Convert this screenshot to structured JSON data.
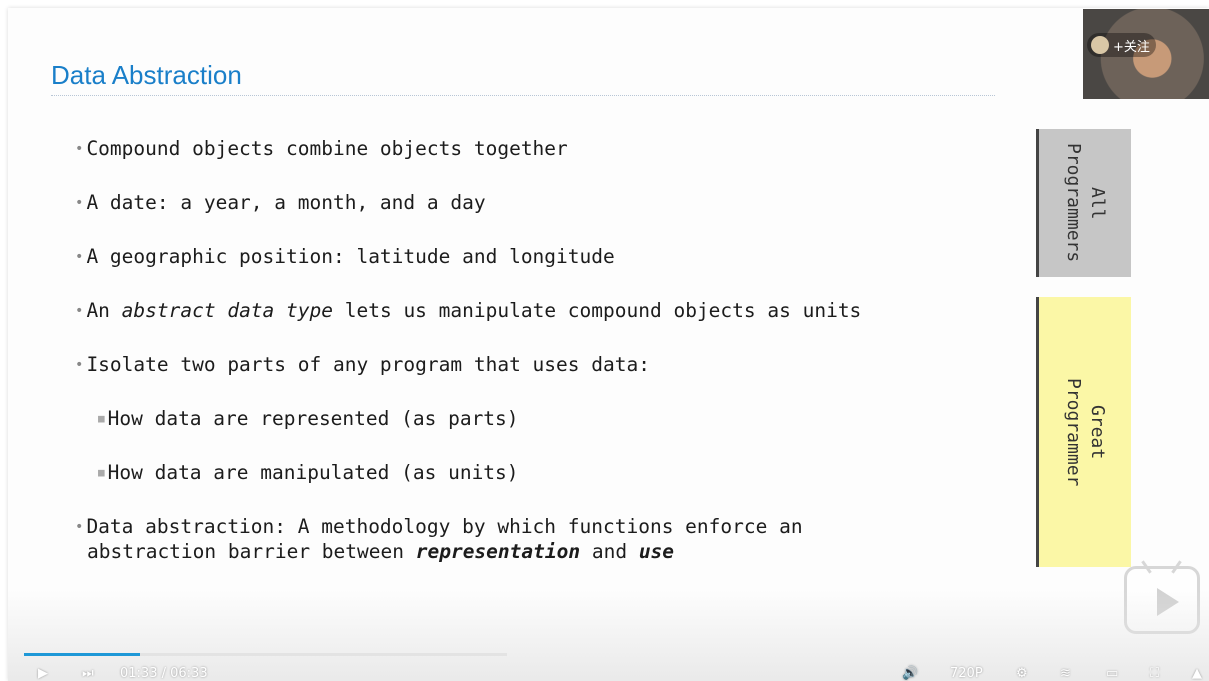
{
  "slide": {
    "title": "Data Abstraction",
    "bullets": [
      {
        "text": "Compound objects combine objects together"
      },
      {
        "text": "A date: a year, a month, and a day"
      },
      {
        "text": "A geographic position: latitude and longitude"
      },
      {
        "pre": "An ",
        "em": "abstract data type",
        "post": " lets us manipulate compound objects as units"
      },
      {
        "text": "Isolate two parts of any program that uses data:"
      },
      {
        "text": "How data are represented (as parts)"
      },
      {
        "text": "How data are manipulated (as units)"
      },
      {
        "line1": "Data abstraction: A methodology by which functions enforce an",
        "line2_pre": "abstraction barrier between ",
        "line2_em1": "representation",
        "line2_mid": " and ",
        "line2_em2": "use"
      }
    ],
    "side_boxes": {
      "all": "All\nProgrammers",
      "great": "Great\nProgrammer",
      "all_color": "#c6c6c6",
      "great_color": "#fbf7a6"
    },
    "title_color": "#1a7fc9"
  },
  "webcam": {
    "follow_label": "+关注"
  },
  "player": {
    "time_current": "01:33",
    "time_total": "06:33",
    "time_sep": " / ",
    "quality": "720P",
    "progress_fraction": 0.24,
    "accent": "#1e98d7",
    "icons": [
      "play-icon",
      "next-icon",
      "volume-icon",
      "settings-icon",
      "danmaku-icon",
      "widescreen-icon",
      "fullscreen-icon"
    ]
  }
}
